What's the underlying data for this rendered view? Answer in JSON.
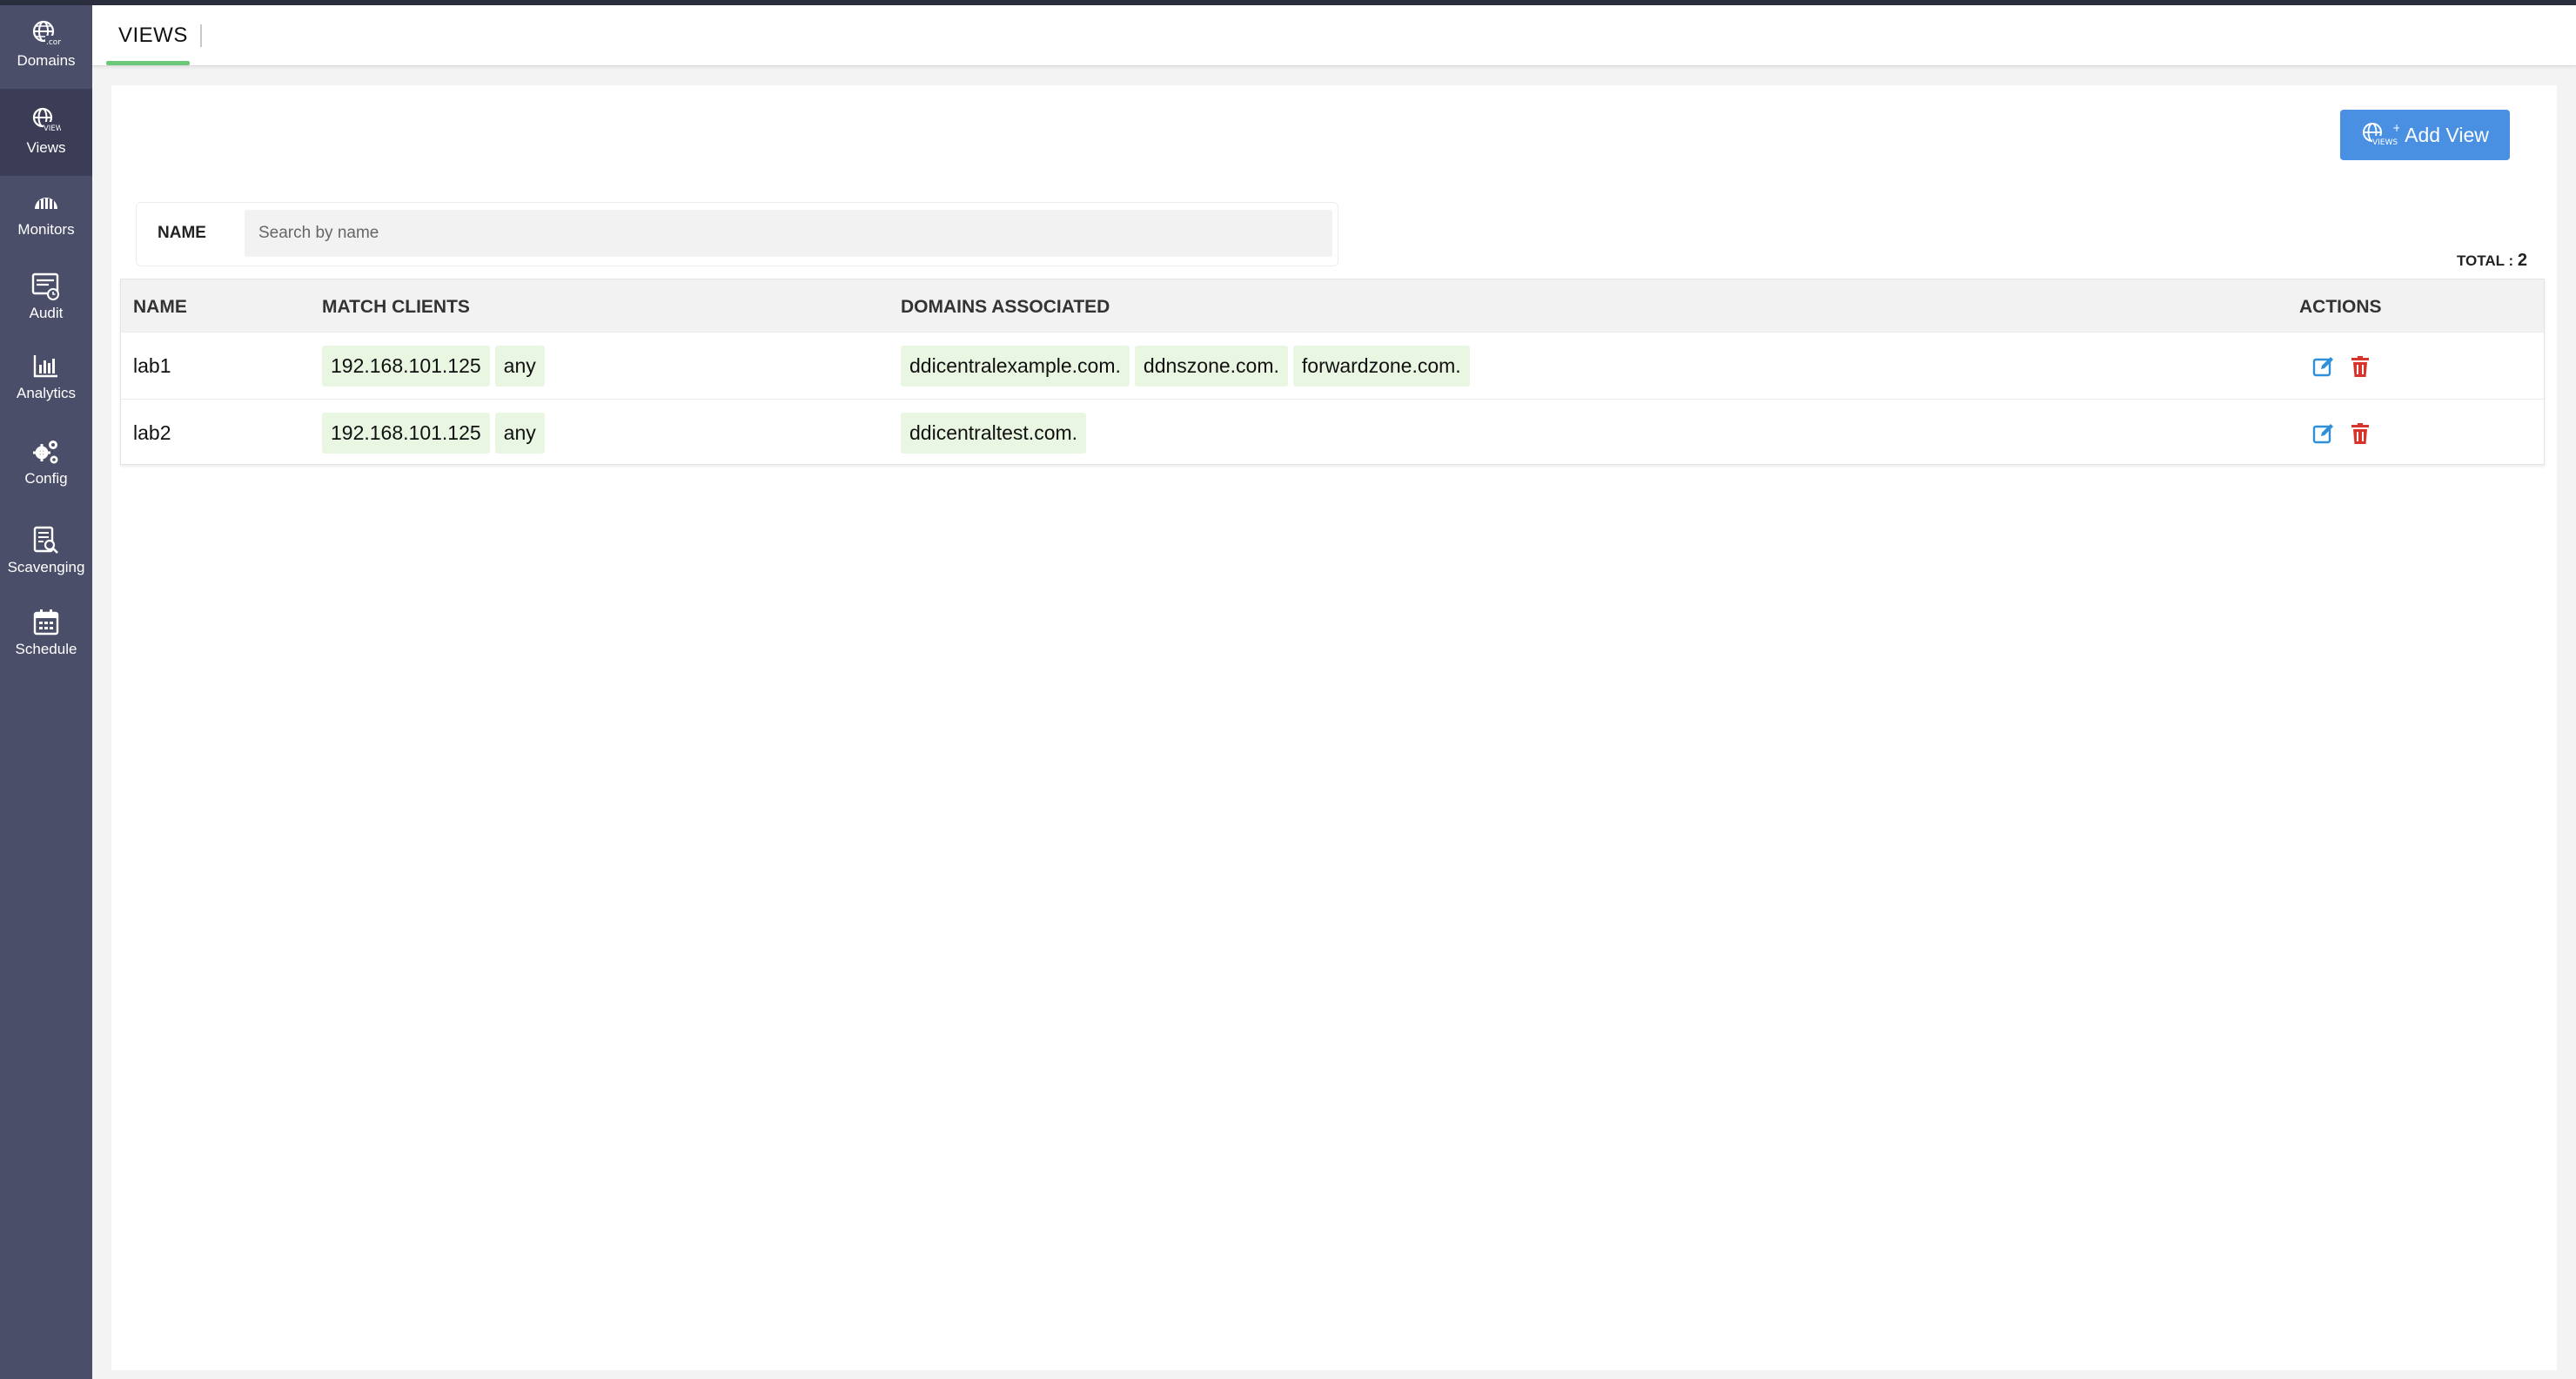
{
  "sidebar": {
    "items": [
      {
        "label": "Domains",
        "icon": "globe-com-icon"
      },
      {
        "label": "Views",
        "icon": "globe-views-icon"
      },
      {
        "label": "Monitors",
        "icon": "monitor-icon"
      },
      {
        "label": "Audit",
        "icon": "audit-icon"
      },
      {
        "label": "Analytics",
        "icon": "analytics-icon"
      },
      {
        "label": "Config",
        "icon": "gears-icon"
      },
      {
        "label": "Scavenging",
        "icon": "scavenging-icon"
      },
      {
        "label": "Schedule",
        "icon": "calendar-icon"
      }
    ],
    "active": "Views"
  },
  "header": {
    "tab": "VIEWS"
  },
  "toolbar": {
    "add_label": "Add View"
  },
  "filter": {
    "label": "NAME",
    "placeholder": "Search by name",
    "value": ""
  },
  "total": {
    "label": "TOTAL :",
    "value": "2"
  },
  "table": {
    "columns": [
      "NAME",
      "MATCH CLIENTS",
      "DOMAINS ASSOCIATED",
      "ACTIONS"
    ],
    "rows": [
      {
        "name": "lab1",
        "clients": [
          "192.168.101.125",
          "any"
        ],
        "domains": [
          "ddicentralexample.com.",
          "ddnszone.com.",
          "forwardzone.com."
        ]
      },
      {
        "name": "lab2",
        "clients": [
          "192.168.101.125",
          "any"
        ],
        "domains": [
          "ddicentraltest.com."
        ]
      }
    ]
  },
  "colors": {
    "sidebar": "#4b4e69",
    "accent": "#4a90e2",
    "chip": "#e9f6e2",
    "edit": "#2f8fd8",
    "delete": "#d9342b",
    "tab_underline": "#6cc97a"
  }
}
